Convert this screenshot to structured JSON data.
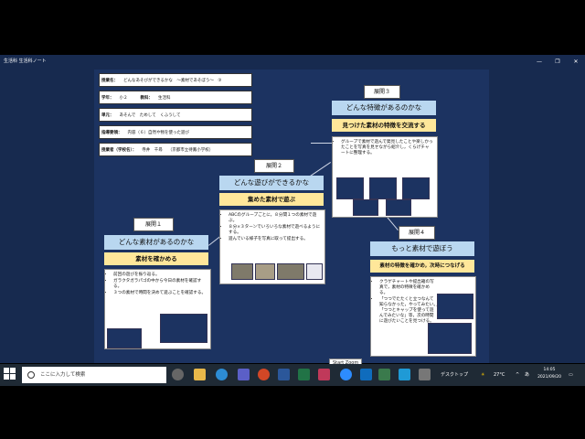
{
  "window": {
    "title": "生活科 生活科ノート",
    "controls": [
      "—",
      "❐",
      "✕"
    ]
  },
  "info": {
    "lesson_title_label": "授業名：",
    "lesson_title": "どんなあそびができるかな　～素材であそぼう～　③",
    "grade_label": "学年：",
    "grade": "小２",
    "subject_label": "教科：",
    "subject": "生活科",
    "unit_label": "単元：",
    "unit": "あそんで　ためして　くふうして",
    "guideline_label": "指導要領：",
    "guideline": "内容（６）自然や物を使った遊び",
    "teacher_label": "授業者（学校名）：",
    "teacher": "寺井　千尋",
    "school": "（京都市立待鳳小学校）"
  },
  "stages": [
    {
      "label": "展開１",
      "head": "どんな素材があるのかな",
      "sub": "素材を確かめる",
      "bullets": [
        "前回の遊びを振り返る。",
        "ガラクタガラパゴの中から今日の素材を確認する。",
        "３つの素材で時間を決めて遊ぶことを確認する。"
      ]
    },
    {
      "label": "展開２",
      "head": "どんな遊びができるかな",
      "sub": "集めた素材で遊ぶ",
      "bullets": [
        "ABCのグループごとに，８分間１つの素材で遊ぶ。",
        "８分×３ターンでいろいろな素材で遊べるようにする。",
        "遊んでいる様子を写真に取って提出する。"
      ]
    },
    {
      "label": "展開３",
      "head": "どんな特徴があるのかな",
      "sub": "見つけた素材の特徴を交流する",
      "bullets": [
        "グループで素材で遊んで発見したことや楽しかったことを写真を見せながら紹介し，くらげチャートに整理する。"
      ]
    },
    {
      "label": "展開４",
      "head": "もっと素材で遊ぼう",
      "sub": "素材の特徴を確かめ，次時につなげる",
      "bullets": [
        "クラゲチャートや提出箱の写真で，素材の特徴を確かめる。",
        "「つつでたたくと立つなんて知らなかった，やってみたい。」「つつとキャップを使って遊んでみたいな」等，次の時間に遊びたいことを見つける。"
      ]
    }
  ],
  "zoom_tooltip": "Start Zoom",
  "taskbar": {
    "search_placeholder": "ここに入力して検索",
    "desktop_label": "デスクトップ",
    "temperature": "27°C",
    "ime": "あ",
    "time": "14:05",
    "date": "2021/09/20"
  },
  "colors": {
    "window_bg": "#172a4f",
    "canvas_bg": "#1c3361",
    "stage_head": "#b9d7f0",
    "stage_sub": "#ffe79a",
    "taskbar": "#1f2a35"
  }
}
